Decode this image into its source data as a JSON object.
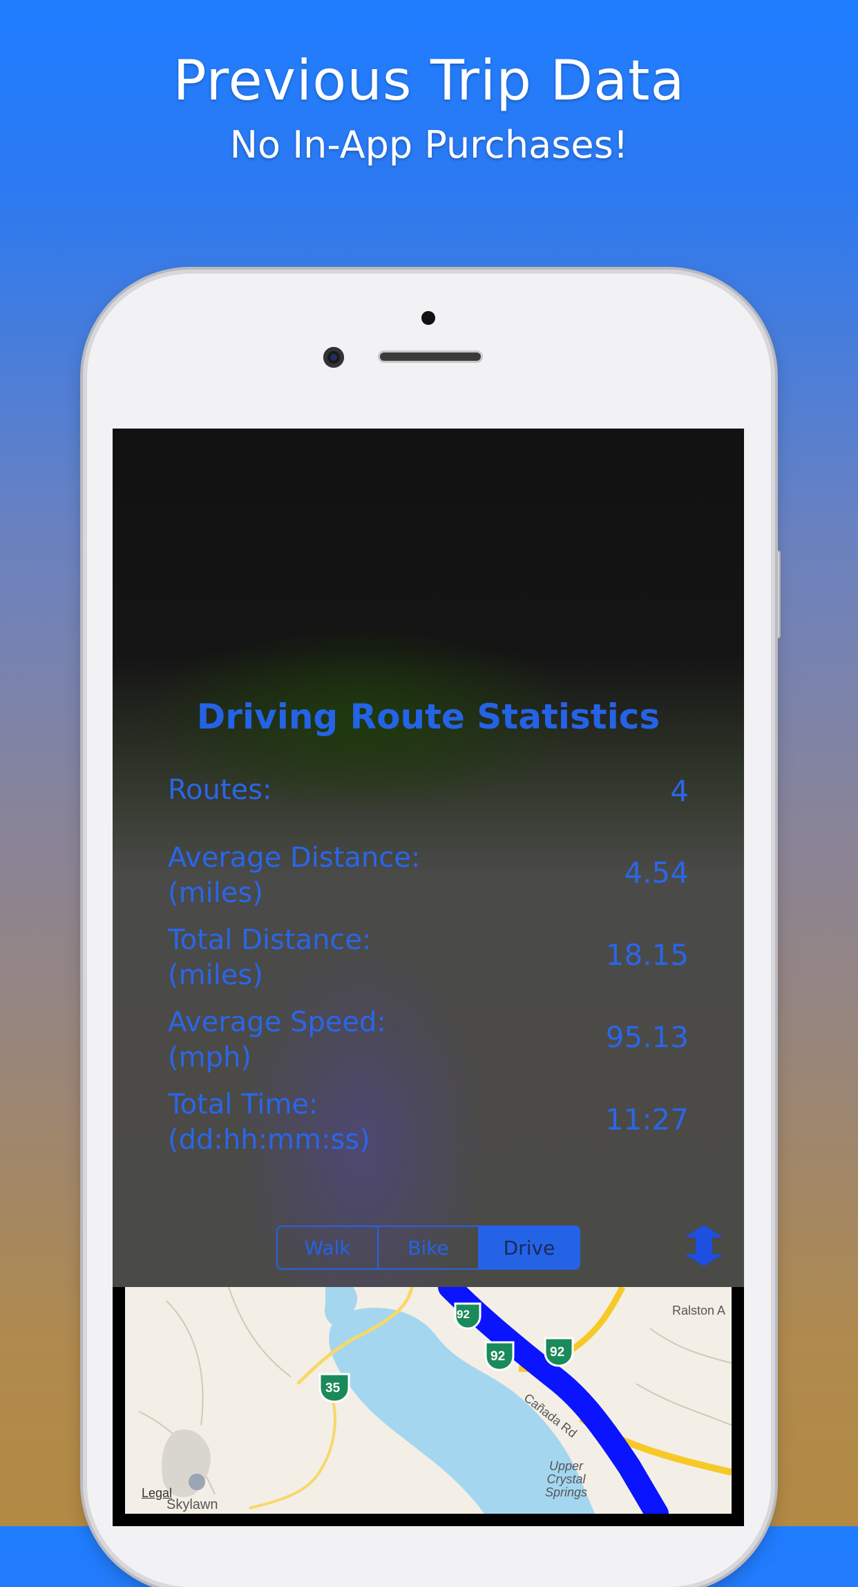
{
  "promo": {
    "title": "Previous Trip Data",
    "subtitle": "No In-App Purchases!"
  },
  "stats": {
    "title": "Driving Route Statistics",
    "rows": [
      {
        "label": "Routes:",
        "value": "4"
      },
      {
        "label": "Average Distance:\n(miles)",
        "value": "4.54"
      },
      {
        "label": "Total Distance:\n(miles)",
        "value": "18.15"
      },
      {
        "label": "Average Speed:\n(mph)",
        "value": "95.13"
      },
      {
        "label": "Total Time:\n(dd:hh:mm:ss)",
        "value": "11:27"
      }
    ]
  },
  "mode_selector": {
    "options": [
      "Walk",
      "Bike",
      "Drive"
    ],
    "selected": "Drive"
  },
  "map": {
    "legal": "Legal",
    "labels": {
      "road_ralston": "Ralston A",
      "road_canada": "Cañada Rd",
      "water": "Upper\nCrystal\nSprings",
      "place": "Skylawn"
    },
    "shields": [
      "92",
      "92",
      "92",
      "35"
    ]
  },
  "colors": {
    "accent": "#2563e6",
    "route": "#0a14ff"
  }
}
